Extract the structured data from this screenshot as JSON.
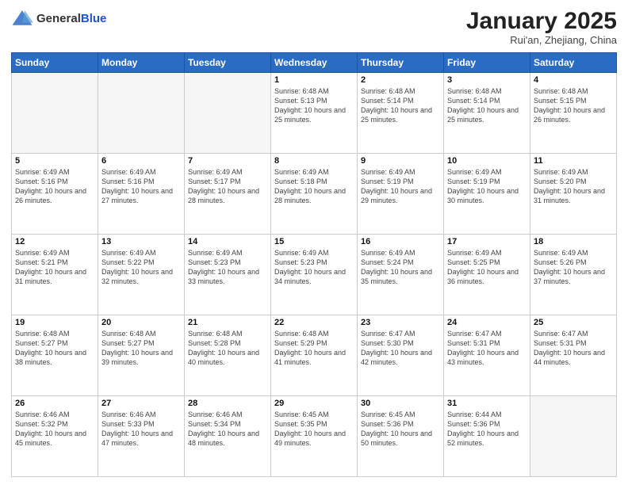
{
  "header": {
    "logo_general": "General",
    "logo_blue": "Blue",
    "month_title": "January 2025",
    "location": "Rui'an, Zhejiang, China"
  },
  "weekdays": [
    "Sunday",
    "Monday",
    "Tuesday",
    "Wednesday",
    "Thursday",
    "Friday",
    "Saturday"
  ],
  "weeks": [
    [
      {
        "day": "",
        "info": ""
      },
      {
        "day": "",
        "info": ""
      },
      {
        "day": "",
        "info": ""
      },
      {
        "day": "1",
        "info": "Sunrise: 6:48 AM\nSunset: 5:13 PM\nDaylight: 10 hours and 25 minutes."
      },
      {
        "day": "2",
        "info": "Sunrise: 6:48 AM\nSunset: 5:14 PM\nDaylight: 10 hours and 25 minutes."
      },
      {
        "day": "3",
        "info": "Sunrise: 6:48 AM\nSunset: 5:14 PM\nDaylight: 10 hours and 25 minutes."
      },
      {
        "day": "4",
        "info": "Sunrise: 6:48 AM\nSunset: 5:15 PM\nDaylight: 10 hours and 26 minutes."
      }
    ],
    [
      {
        "day": "5",
        "info": "Sunrise: 6:49 AM\nSunset: 5:16 PM\nDaylight: 10 hours and 26 minutes."
      },
      {
        "day": "6",
        "info": "Sunrise: 6:49 AM\nSunset: 5:16 PM\nDaylight: 10 hours and 27 minutes."
      },
      {
        "day": "7",
        "info": "Sunrise: 6:49 AM\nSunset: 5:17 PM\nDaylight: 10 hours and 28 minutes."
      },
      {
        "day": "8",
        "info": "Sunrise: 6:49 AM\nSunset: 5:18 PM\nDaylight: 10 hours and 28 minutes."
      },
      {
        "day": "9",
        "info": "Sunrise: 6:49 AM\nSunset: 5:19 PM\nDaylight: 10 hours and 29 minutes."
      },
      {
        "day": "10",
        "info": "Sunrise: 6:49 AM\nSunset: 5:19 PM\nDaylight: 10 hours and 30 minutes."
      },
      {
        "day": "11",
        "info": "Sunrise: 6:49 AM\nSunset: 5:20 PM\nDaylight: 10 hours and 31 minutes."
      }
    ],
    [
      {
        "day": "12",
        "info": "Sunrise: 6:49 AM\nSunset: 5:21 PM\nDaylight: 10 hours and 31 minutes."
      },
      {
        "day": "13",
        "info": "Sunrise: 6:49 AM\nSunset: 5:22 PM\nDaylight: 10 hours and 32 minutes."
      },
      {
        "day": "14",
        "info": "Sunrise: 6:49 AM\nSunset: 5:23 PM\nDaylight: 10 hours and 33 minutes."
      },
      {
        "day": "15",
        "info": "Sunrise: 6:49 AM\nSunset: 5:23 PM\nDaylight: 10 hours and 34 minutes."
      },
      {
        "day": "16",
        "info": "Sunrise: 6:49 AM\nSunset: 5:24 PM\nDaylight: 10 hours and 35 minutes."
      },
      {
        "day": "17",
        "info": "Sunrise: 6:49 AM\nSunset: 5:25 PM\nDaylight: 10 hours and 36 minutes."
      },
      {
        "day": "18",
        "info": "Sunrise: 6:49 AM\nSunset: 5:26 PM\nDaylight: 10 hours and 37 minutes."
      }
    ],
    [
      {
        "day": "19",
        "info": "Sunrise: 6:48 AM\nSunset: 5:27 PM\nDaylight: 10 hours and 38 minutes."
      },
      {
        "day": "20",
        "info": "Sunrise: 6:48 AM\nSunset: 5:27 PM\nDaylight: 10 hours and 39 minutes."
      },
      {
        "day": "21",
        "info": "Sunrise: 6:48 AM\nSunset: 5:28 PM\nDaylight: 10 hours and 40 minutes."
      },
      {
        "day": "22",
        "info": "Sunrise: 6:48 AM\nSunset: 5:29 PM\nDaylight: 10 hours and 41 minutes."
      },
      {
        "day": "23",
        "info": "Sunrise: 6:47 AM\nSunset: 5:30 PM\nDaylight: 10 hours and 42 minutes."
      },
      {
        "day": "24",
        "info": "Sunrise: 6:47 AM\nSunset: 5:31 PM\nDaylight: 10 hours and 43 minutes."
      },
      {
        "day": "25",
        "info": "Sunrise: 6:47 AM\nSunset: 5:31 PM\nDaylight: 10 hours and 44 minutes."
      }
    ],
    [
      {
        "day": "26",
        "info": "Sunrise: 6:46 AM\nSunset: 5:32 PM\nDaylight: 10 hours and 45 minutes."
      },
      {
        "day": "27",
        "info": "Sunrise: 6:46 AM\nSunset: 5:33 PM\nDaylight: 10 hours and 47 minutes."
      },
      {
        "day": "28",
        "info": "Sunrise: 6:46 AM\nSunset: 5:34 PM\nDaylight: 10 hours and 48 minutes."
      },
      {
        "day": "29",
        "info": "Sunrise: 6:45 AM\nSunset: 5:35 PM\nDaylight: 10 hours and 49 minutes."
      },
      {
        "day": "30",
        "info": "Sunrise: 6:45 AM\nSunset: 5:36 PM\nDaylight: 10 hours and 50 minutes."
      },
      {
        "day": "31",
        "info": "Sunrise: 6:44 AM\nSunset: 5:36 PM\nDaylight: 10 hours and 52 minutes."
      },
      {
        "day": "",
        "info": ""
      }
    ]
  ]
}
